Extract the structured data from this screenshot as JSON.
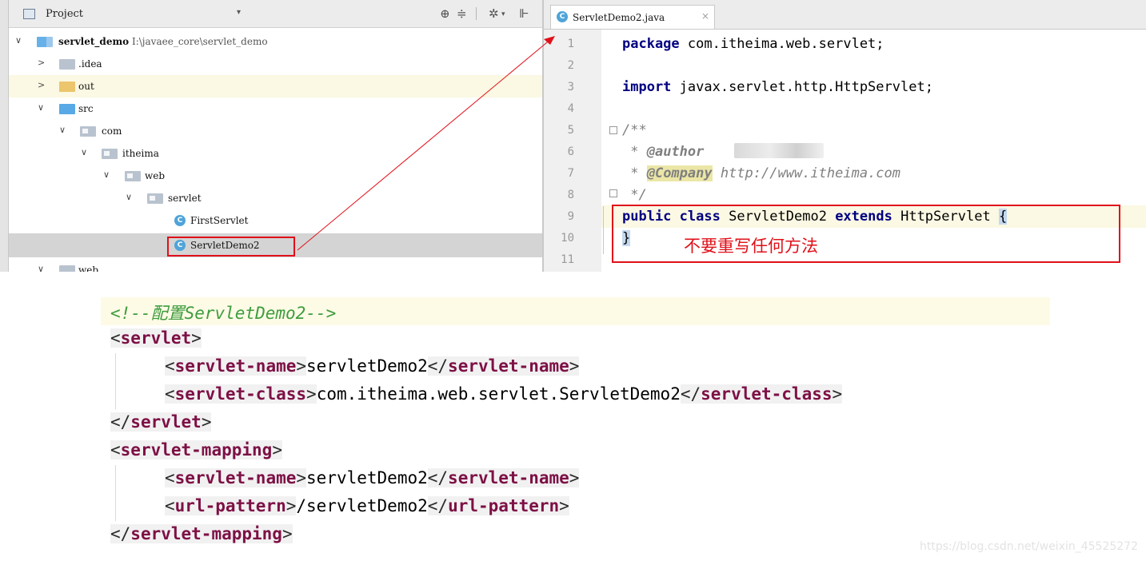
{
  "project_panel": {
    "title": "Project",
    "dropdown_glyph": "▾",
    "toolbar_icons": [
      "target-icon",
      "collapse-icon",
      "gear-icon",
      "hide-icon"
    ],
    "tree": [
      {
        "label": "servlet_demo",
        "path": "I:\\javaee_core\\servlet_demo",
        "arrow": "∨",
        "icon": "module-folder-icon"
      },
      {
        "label": ".idea",
        "arrow": ">",
        "icon": "folder-icon"
      },
      {
        "label": "out",
        "arrow": ">",
        "icon": "folder-orange-icon"
      },
      {
        "label": "src",
        "arrow": "∨",
        "icon": "source-folder-icon"
      },
      {
        "label": "com",
        "arrow": "∨",
        "icon": "package-icon"
      },
      {
        "label": "itheima",
        "arrow": "∨",
        "icon": "package-icon"
      },
      {
        "label": "web",
        "arrow": "∨",
        "icon": "package-icon"
      },
      {
        "label": "servlet",
        "arrow": "∨",
        "icon": "package-icon"
      },
      {
        "label": "FirstServlet",
        "icon": "class-icon"
      },
      {
        "label": "ServletDemo2",
        "icon": "class-icon"
      },
      {
        "label": "web",
        "arrow": "∨",
        "icon": "folder-icon"
      }
    ]
  },
  "editor": {
    "tab": {
      "label": "ServletDemo2.java",
      "close": "×",
      "icon_letter": "C"
    },
    "line_numbers": [
      "1",
      "2",
      "3",
      "4",
      "5",
      "6",
      "7",
      "8",
      "9",
      "10",
      "11"
    ],
    "code": {
      "l1_kw": "package",
      "l1_rest": " com.itheima.web.servlet;",
      "l3_kw": "import",
      "l3_rest": " javax.servlet.http.HttpServlet;",
      "l5": "/**",
      "l6_star": " * ",
      "l6_tag": "@author",
      "l7_star": " * ",
      "l7_tag": "@Company",
      "l7_rest": " http://www.itheima.com",
      "l8": " */",
      "l9_kw1": "public",
      "l9_kw2": "class",
      "l9_name": "ServletDemo2",
      "l9_kw3": "extends",
      "l9_parent": "HttpServlet",
      "l9_brace": "{",
      "l10_brace": "}"
    },
    "annotation": "不要重写任何方法"
  },
  "xml": {
    "comment": "<!--配置ServletDemo2-->",
    "servlet_open": "servlet",
    "servlet_name_tag": "servlet-name",
    "servlet_name_value": "servletDemo2",
    "servlet_class_tag": "servlet-class",
    "servlet_class_value": "com.itheima.web.servlet.ServletDemo2",
    "mapping_tag": "servlet-mapping",
    "url_pattern_tag": "url-pattern",
    "url_pattern_value": "/servletDemo2"
  },
  "watermark": "https://blog.csdn.net/weixin_45525272",
  "colors": {
    "highlight_red": "#e0101a",
    "keyword": "#000080",
    "xml_tag": "#7d1045",
    "xml_comment": "#3e9c3e"
  }
}
